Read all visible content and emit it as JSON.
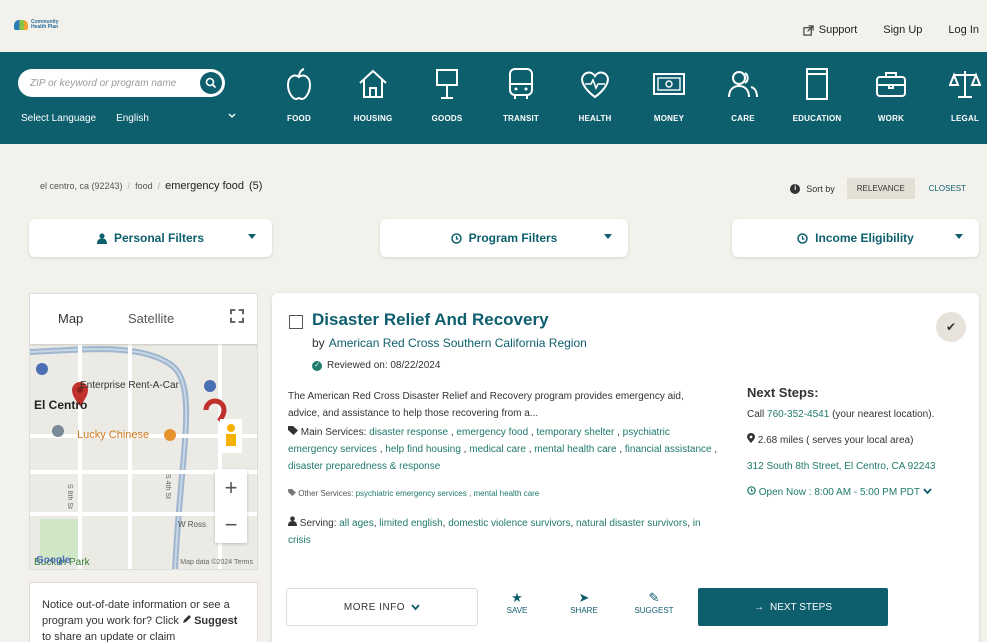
{
  "header": {
    "logo_text": "Community Health Plan",
    "links": [
      "Support",
      "Sign Up",
      "Log In"
    ]
  },
  "nav": {
    "search_placeholder": "ZIP or keyword or program name",
    "select_language_label": "Select Language",
    "language_value": "English",
    "categories": [
      "FOOD",
      "HOUSING",
      "GOODS",
      "TRANSIT",
      "HEALTH",
      "MONEY",
      "CARE",
      "EDUCATION",
      "WORK",
      "LEGAL"
    ]
  },
  "breadcrumb": {
    "items": [
      "el centro, ca (92243)",
      "food"
    ],
    "current": "emergency food",
    "count": "(5)"
  },
  "sort": {
    "label": "Sort by",
    "options": [
      "RELEVANCE",
      "CLOSEST"
    ],
    "selected": "RELEVANCE"
  },
  "filters": {
    "personal": "Personal Filters",
    "program": "Program Filters",
    "income": "Income Eligibility"
  },
  "map": {
    "tabs": [
      "Map",
      "Satellite"
    ],
    "labels": [
      "Enterprise Rent-A-Car",
      "El Centro",
      "Lucky Chinese",
      "W Ross",
      "Bucklin Park",
      "S 8th St",
      "S 4th St"
    ],
    "attribution": "Map data ©2024  Terms",
    "google": "Google"
  },
  "notice": {
    "text": "Notice out-of-date information or see a program you work for? Click",
    "bold": "Suggest",
    "tail": "to share an update or claim"
  },
  "program": {
    "title": "Disaster Relief And Recovery",
    "by_label": "by",
    "provider": "American Red Cross Southern California Region",
    "reviewed": "Reviewed on: 08/22/2024",
    "description": "The American Red Cross Disaster Relief and Recovery program provides emergency aid, advice, and assistance to help those recovering from a...",
    "main_services_label": "Main Services:",
    "main_services": [
      "disaster response",
      "emergency food",
      "temporary shelter",
      "psychiatric emergency services",
      "help find housing",
      "medical care",
      "mental health care",
      "financial assistance",
      "disaster preparedness & response"
    ],
    "other_services_label": "Other Services:",
    "other_services": [
      "psychiatric emergency services",
      "mental health care"
    ],
    "serving_label": "Serving:",
    "serving": [
      "all ages",
      "limited english",
      "domestic violence survivors",
      "natural disaster survivors",
      "in crisis"
    ]
  },
  "next_steps": {
    "heading": "Next Steps:",
    "call_prefix": "Call",
    "phone": "760-352-4541",
    "call_suffix": "(your nearest location).",
    "distance": "2.68 miles ( serves your local area)",
    "address": "312 South 8th Street, El Centro, CA 92243",
    "hours": "Open Now : 8:00 AM - 5:00 PM PDT"
  },
  "actions": {
    "more_info": "MORE INFO",
    "save": "SAVE",
    "share": "SHARE",
    "suggest": "SUGGEST",
    "next_steps": "NEXT STEPS"
  },
  "colors": {
    "brand_teal": "#0e5f6e",
    "tag_green": "#1f7a6b",
    "background": "#f3f1ec"
  }
}
